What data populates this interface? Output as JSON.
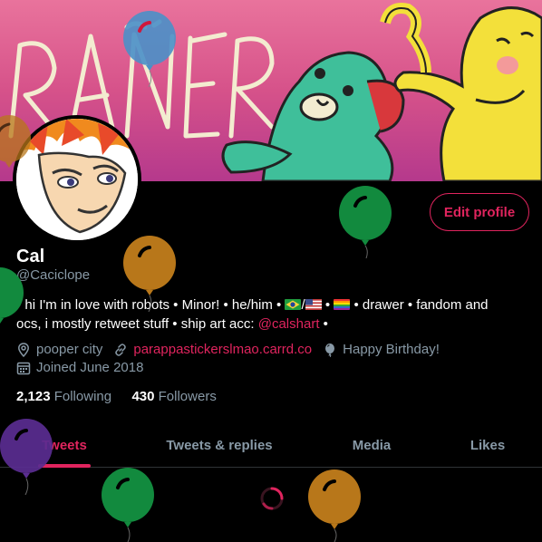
{
  "profile": {
    "display_name": "Cal",
    "handle": "@Caciclope",
    "edit_button": "Edit profile"
  },
  "bio": {
    "line1": "• hi I'm in love with robots • Minor! • he/him •",
    "flag_sep": "/",
    "mid": "•",
    "after_flags": "• drawer • fandom and",
    "line2": "ocs, i mostly retweet stuff • ship art acc: ",
    "link": "@calshart",
    "end": " •"
  },
  "meta": {
    "location": "pooper city",
    "website": "parappastickerslmao.carrd.co",
    "birthday": "Happy Birthday!",
    "joined": "Joined June 2018"
  },
  "stats": {
    "following_count": "2,123",
    "following_label": "Following",
    "followers_count": "430",
    "followers_label": "Followers"
  },
  "tabs": {
    "tweets": "Tweets",
    "replies": "Tweets & replies",
    "media": "Media",
    "likes": "Likes",
    "active": "tweets"
  },
  "icons": {
    "location": "location-pin-icon",
    "link": "link-icon",
    "birthday": "balloon-icon",
    "calendar": "calendar-icon"
  },
  "colors": {
    "accent": "#e0245e",
    "muted": "#8899a6",
    "background": "#000000",
    "balloon_blue": "#4a90c8",
    "balloon_green": "#128a3e",
    "balloon_orange": "#b8771a",
    "balloon_purple": "#5a2d91"
  }
}
